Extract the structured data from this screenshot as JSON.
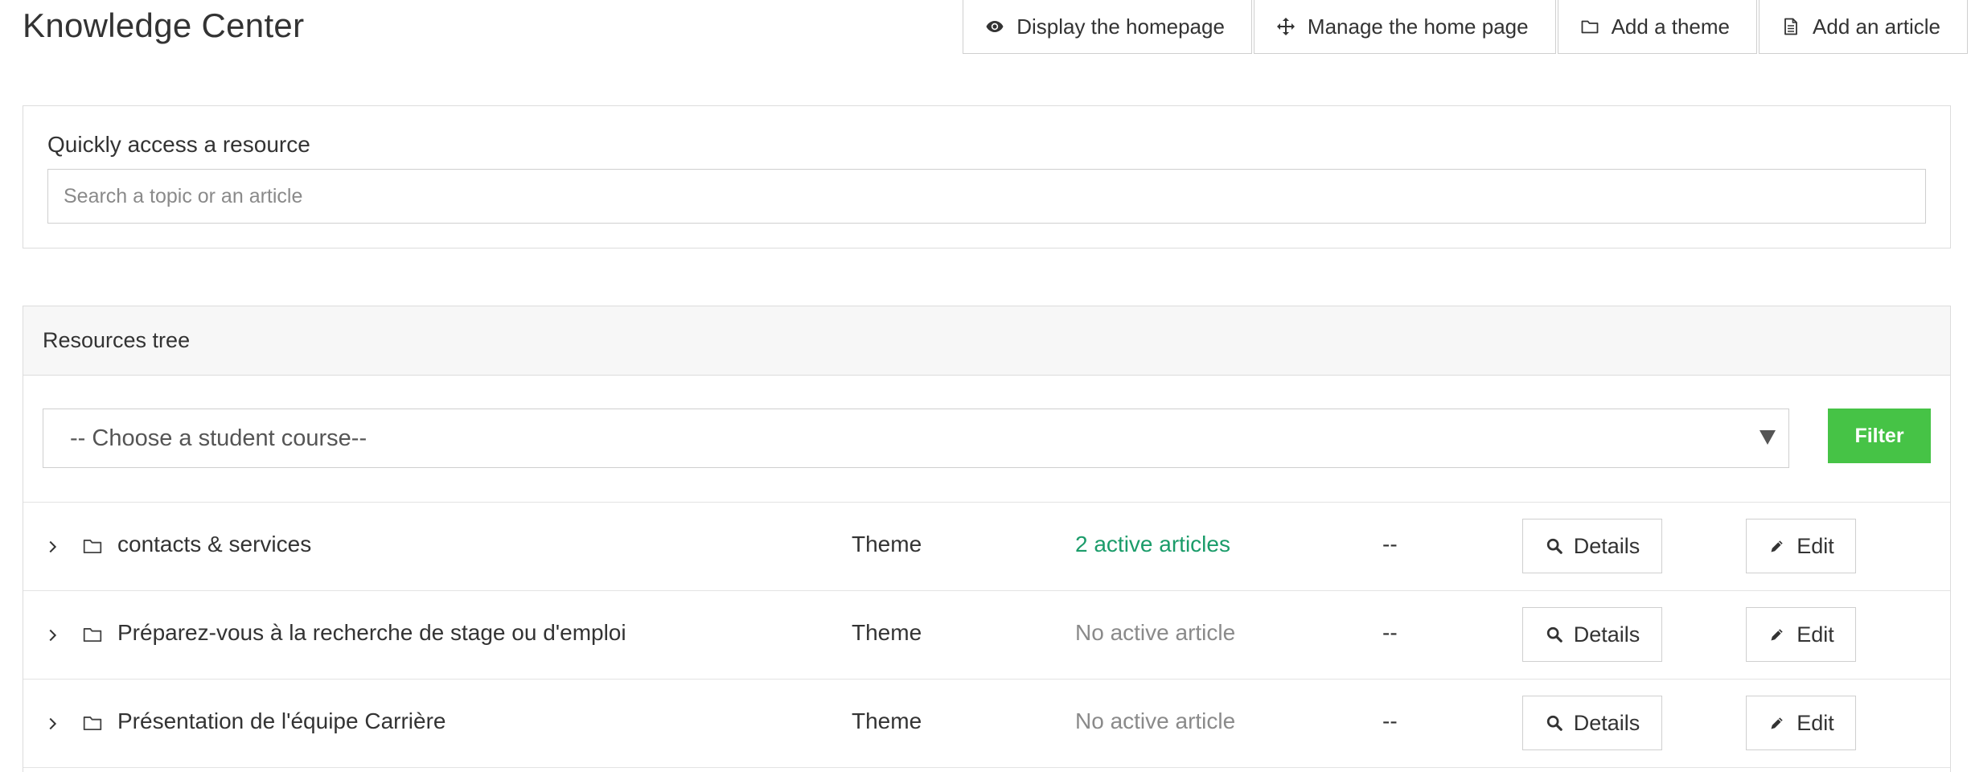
{
  "page": {
    "title": "Knowledge Center"
  },
  "toolbar": {
    "display_homepage": {
      "label": "Display the homepage",
      "icon": "eye-icon"
    },
    "manage_homepage": {
      "label": "Manage the home page",
      "icon": "move-arrows-icon"
    },
    "add_theme": {
      "label": "Add a theme",
      "icon": "folder-icon"
    },
    "add_article": {
      "label": "Add an article",
      "icon": "document-icon"
    }
  },
  "quick_access": {
    "label": "Quickly access a resource",
    "search_placeholder": "Search a topic or an article",
    "search_value": ""
  },
  "resources_tree": {
    "header": "Resources tree",
    "course_select": {
      "selected": "-- Choose a student course--"
    },
    "filter_label": "Filter",
    "rows": [
      {
        "name": "contacts & services",
        "type": "Theme",
        "articles": "2 active articles",
        "active": true,
        "extra": "--",
        "details_label": "Details",
        "edit_label": "Edit"
      },
      {
        "name": "Préparez-vous à la recherche de stage ou d'emploi",
        "type": "Theme",
        "articles": "No active article",
        "active": false,
        "extra": "--",
        "details_label": "Details",
        "edit_label": "Edit"
      },
      {
        "name": "Présentation de l'équipe Carrière",
        "type": "Theme",
        "articles": "No active article",
        "active": false,
        "extra": "--",
        "details_label": "Details",
        "edit_label": "Edit"
      }
    ]
  },
  "colors": {
    "filter_button": "#46c346",
    "active_articles": "#1b9c6a",
    "inactive_articles": "#8a8a8a",
    "border": "#cfcfcf",
    "header_bg": "#f7f7f7"
  }
}
